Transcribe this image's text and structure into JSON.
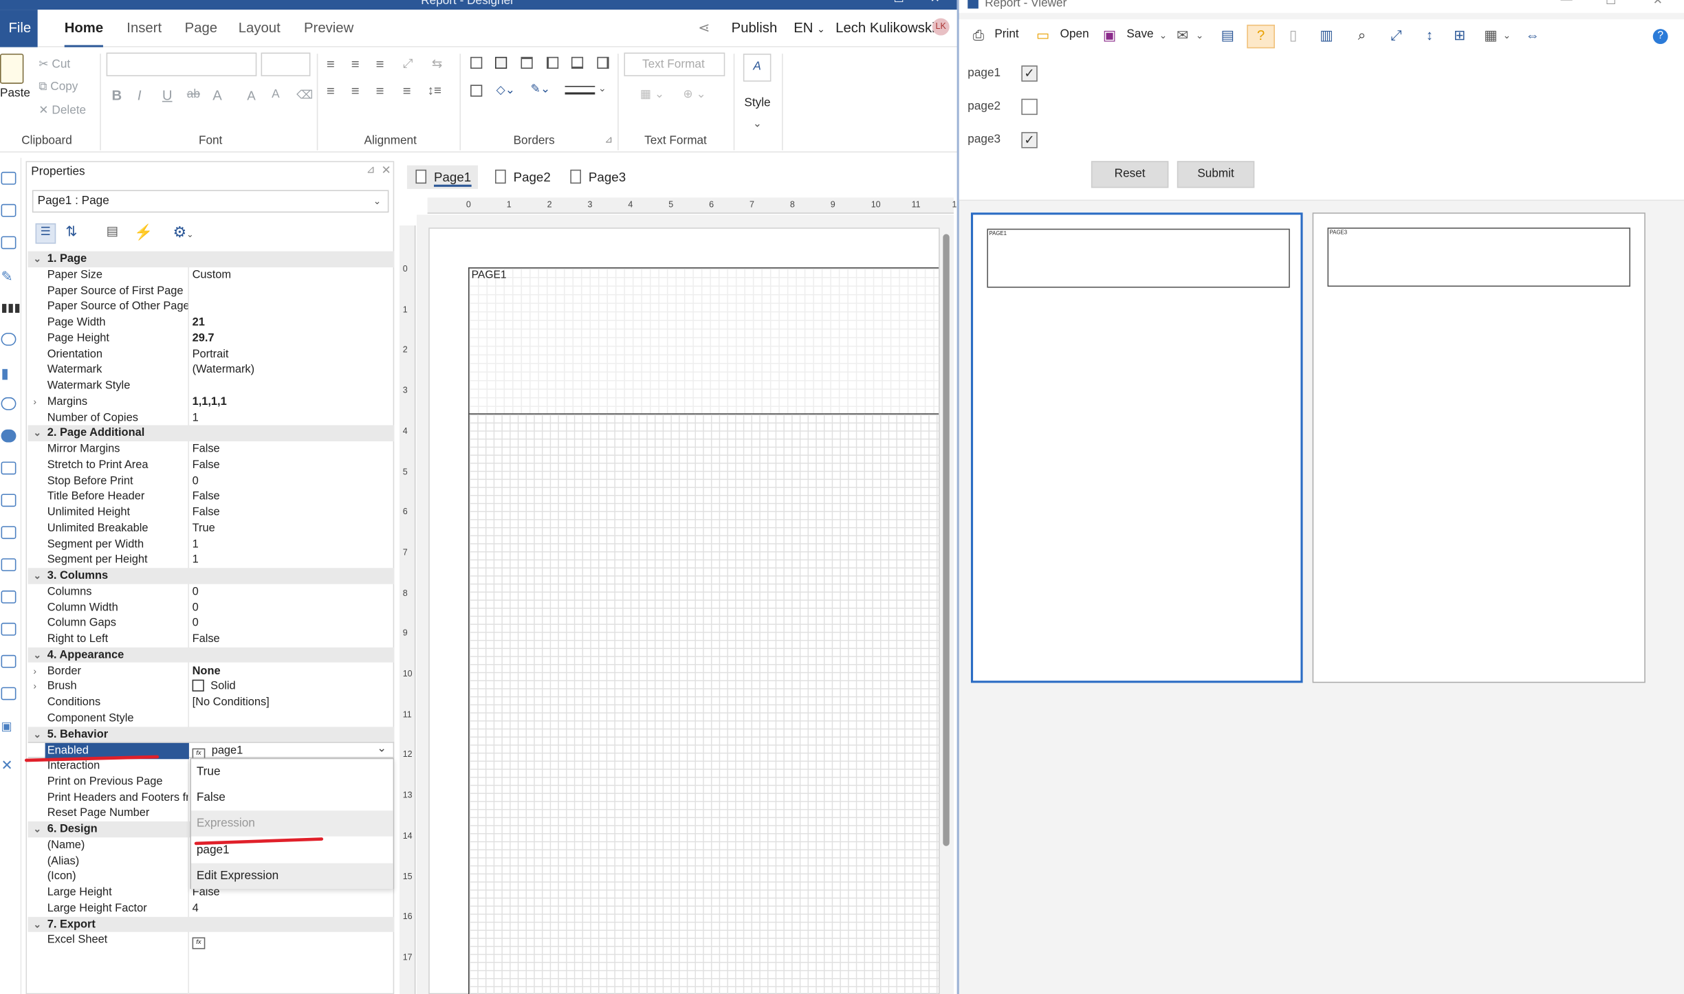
{
  "designer": {
    "window_title": "Report - Designer",
    "menu": {
      "file": "File",
      "tabs": [
        "Home",
        "Insert",
        "Page",
        "Layout",
        "Preview"
      ],
      "active_tab": "Home",
      "publish": "Publish",
      "lang": "EN",
      "user": "Lech Kulikowski",
      "user_initials": "LK"
    },
    "ribbon": {
      "clipboard": {
        "paste": "Paste",
        "cut": "Cut",
        "copy": "Copy",
        "delete": "Delete",
        "title": "Clipboard"
      },
      "font_title": "Font",
      "alignment_title": "Alignment",
      "borders_title": "Borders",
      "text_format": {
        "box": "Text Format",
        "title": "Text Format"
      },
      "style": "Style"
    },
    "properties": {
      "title": "Properties",
      "object": "Page1 : Page",
      "rows": [
        {
          "type": "cat",
          "k": "1. Page"
        },
        {
          "k": "Paper Size",
          "v": "Custom"
        },
        {
          "k": "Paper Source of First Page",
          "v": ""
        },
        {
          "k": "Paper Source of Other Pages",
          "v": ""
        },
        {
          "k": "Page Width",
          "v": "21",
          "bold": true
        },
        {
          "k": "Page Height",
          "v": "29.7",
          "bold": true
        },
        {
          "k": "Orientation",
          "v": "Portrait"
        },
        {
          "k": "Watermark",
          "v": "(Watermark)"
        },
        {
          "k": "Watermark Style",
          "v": ""
        },
        {
          "k": "Margins",
          "v": "1,1,1,1",
          "bold": true,
          "exp": true
        },
        {
          "k": "Number of Copies",
          "v": "1"
        },
        {
          "type": "cat",
          "k": "2. Page  Additional"
        },
        {
          "k": "Mirror Margins",
          "v": "False"
        },
        {
          "k": "Stretch to Print Area",
          "v": "False"
        },
        {
          "k": "Stop Before Print",
          "v": "0"
        },
        {
          "k": "Title Before Header",
          "v": "False"
        },
        {
          "k": "Unlimited Height",
          "v": "False"
        },
        {
          "k": "Unlimited Breakable",
          "v": "True"
        },
        {
          "k": "Segment per Width",
          "v": "1"
        },
        {
          "k": "Segment per Height",
          "v": "1"
        },
        {
          "type": "cat",
          "k": "3. Columns"
        },
        {
          "k": "Columns",
          "v": "0"
        },
        {
          "k": "Column Width",
          "v": "0"
        },
        {
          "k": "Column Gaps",
          "v": "0"
        },
        {
          "k": "Right to Left",
          "v": "False"
        },
        {
          "type": "cat",
          "k": "4. Appearance"
        },
        {
          "k": "Border",
          "v": "None",
          "bold": true,
          "exp": true
        },
        {
          "k": "Brush",
          "v": "Solid",
          "exp": true,
          "swatch": true
        },
        {
          "k": "Conditions",
          "v": "[No Conditions]"
        },
        {
          "k": "Component Style",
          "v": ""
        },
        {
          "type": "cat",
          "k": "5. Behavior"
        },
        {
          "k": "Enabled",
          "v": "page1",
          "sel": true,
          "fx": true
        },
        {
          "k": "Interaction",
          "v": ""
        },
        {
          "k": "Print on Previous Page",
          "v": ""
        },
        {
          "k": "Print Headers and Footers fro",
          "v": ""
        },
        {
          "k": "Reset Page Number",
          "v": ""
        },
        {
          "type": "cat",
          "k": "6. Design"
        },
        {
          "k": "(Name)",
          "v": ""
        },
        {
          "k": "(Alias)",
          "v": ""
        },
        {
          "k": "(Icon)",
          "v": ""
        },
        {
          "k": "Large Height",
          "v": "False"
        },
        {
          "k": "Large Height Factor",
          "v": "4"
        },
        {
          "type": "cat",
          "k": "7. Export"
        },
        {
          "k": "Excel Sheet",
          "v": "",
          "fx": true
        }
      ],
      "dropdown": [
        "True",
        "False",
        "Expression",
        "page1",
        "Edit Expression"
      ]
    },
    "page_tabs": [
      "Page1",
      "Page2",
      "Page3"
    ],
    "ruler_h": [
      "0",
      "1",
      "2",
      "3",
      "4",
      "5",
      "6",
      "7",
      "8",
      "9",
      "10",
      "11",
      "1"
    ],
    "ruler_v": [
      "0",
      "1",
      "2",
      "3",
      "4",
      "5",
      "6",
      "7",
      "8",
      "9",
      "10",
      "11",
      "12",
      "13",
      "14",
      "15",
      "16",
      "17"
    ],
    "band_label": "PAGE1"
  },
  "viewer": {
    "window_title": "Report - Viewer",
    "toolbar": {
      "print": "Print",
      "open": "Open",
      "save": "Save",
      "help": "?"
    },
    "params": [
      {
        "label": "page1",
        "checked": true
      },
      {
        "label": "page2",
        "checked": false
      },
      {
        "label": "page3",
        "checked": true
      }
    ],
    "reset": "Reset",
    "submit": "Submit",
    "pages": [
      "PAGE1",
      "PAGE3"
    ]
  },
  "colors": {
    "accent": "#2b5797",
    "annotation": "#e0202a"
  }
}
